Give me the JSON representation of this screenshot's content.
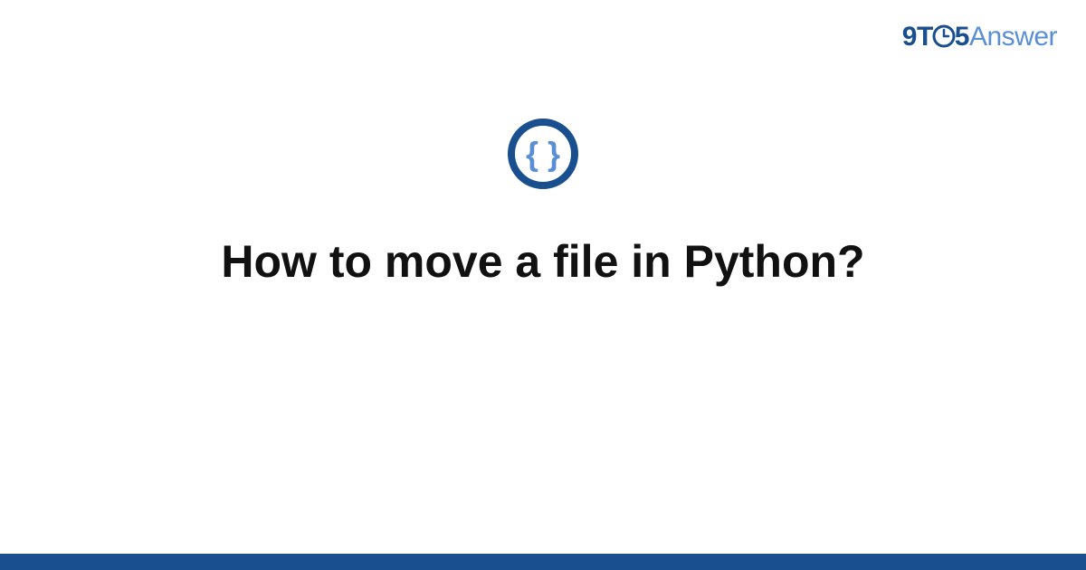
{
  "brand": {
    "prefix_nine": "9",
    "prefix_t": "T",
    "clock_icon_name": "clock-icon",
    "prefix_five": "5",
    "suffix": "Answer"
  },
  "main": {
    "icon_name": "code-braces-icon",
    "title": "How to move a file in Python?"
  },
  "colors": {
    "brand_dark": "#1a4f8f",
    "brand_light": "#5a8fd6",
    "icon_inner": "#5a8fd6",
    "text": "#111111",
    "background": "#ffffff"
  }
}
